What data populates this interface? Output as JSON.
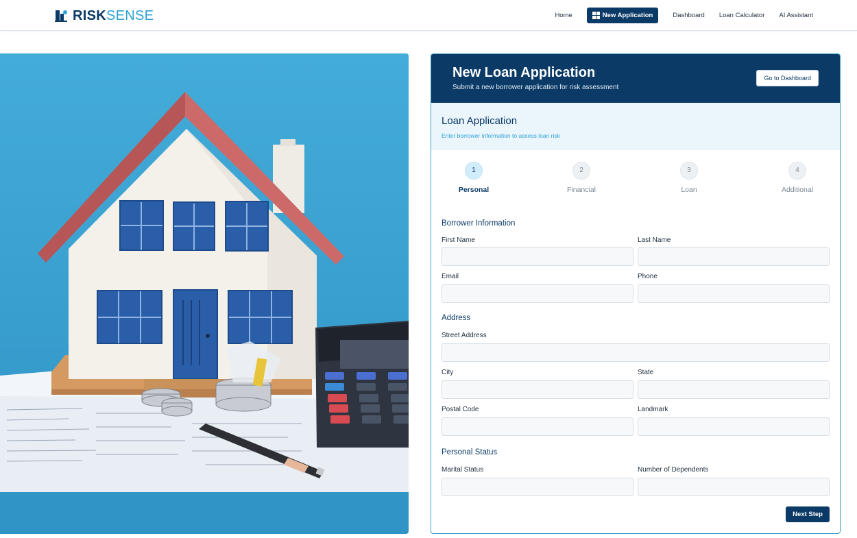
{
  "app": {
    "logo_risk": "RISK",
    "logo_sense": "SENSE"
  },
  "nav": {
    "home": "Home",
    "new_application": "New Application",
    "dashboard": "Dashboard",
    "loan_calculator": "Loan Calculator",
    "ai_assistant": "AI Assistant"
  },
  "header": {
    "title": "New Loan Application",
    "subtitle": "Submit a new borrower application for risk assessment",
    "dashboard_button": "Go to Dashboard"
  },
  "section": {
    "title": "Loan Application",
    "subtitle": "Enter borrower information to assess loan risk"
  },
  "steps": [
    {
      "number": "1",
      "label": "Personal"
    },
    {
      "number": "2",
      "label": "Financial"
    },
    {
      "number": "3",
      "label": "Loan"
    },
    {
      "number": "4",
      "label": "Additional"
    }
  ],
  "form": {
    "borrower_info": {
      "title": "Borrower Information",
      "first_name": "First Name",
      "last_name": "Last Name",
      "email": "Email",
      "phone": "Phone"
    },
    "address": {
      "title": "Address",
      "street": "Street Address",
      "city": "City",
      "state": "State",
      "postal_code": "Postal Code",
      "landmark": "Landmark"
    },
    "personal_status": {
      "title": "Personal Status",
      "marital_status": "Marital Status",
      "dependents": "Number of Dependents"
    },
    "next_button": "Next Step"
  },
  "colors": {
    "primary": "#0b3a66",
    "accent": "#2ea3d6",
    "hero_bg": "#3aa3d2"
  }
}
